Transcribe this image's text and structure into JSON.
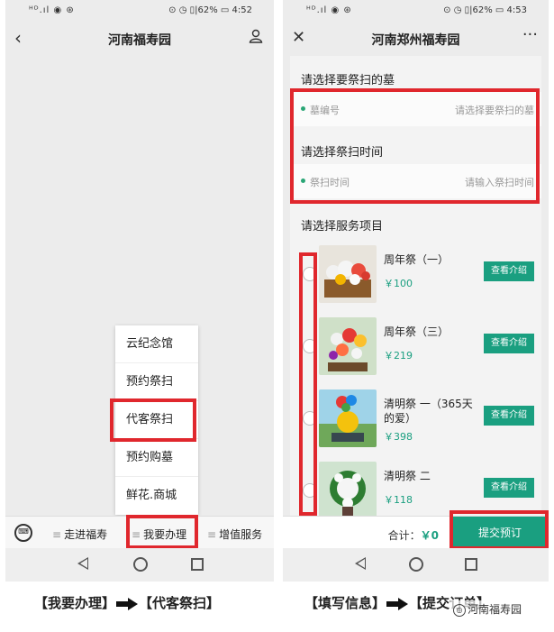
{
  "left": {
    "status_left": "ᴴᴰ.ıl ◉ ⊛",
    "status_right": "⊙ ◷ ▯|62% ▭ 4:52",
    "title": "河南福寿园",
    "back_icon": "chevron-left-icon",
    "user_icon": "user-icon",
    "menu_items": [
      "云纪念馆",
      "预约祭扫",
      "代客祭扫",
      "预约购墓",
      "鲜花.商城"
    ],
    "tabs": [
      "走进福寿",
      "我要办理",
      "增值服务"
    ]
  },
  "right": {
    "status_left": "ᴴᴰ.ıl ◉ ⊛",
    "status_right": "⊙ ◷ ▯|62% ▭ 4:53",
    "title": "河南郑州福寿园",
    "close_icon": "close-icon",
    "more_icon": "more-icon",
    "section_tomb": "请选择要祭扫的墓",
    "tomb_label": "墓编号",
    "tomb_placeholder": "请选择要祭扫的墓",
    "section_time": "请选择祭扫时间",
    "time_label": "祭扫时间",
    "time_placeholder": "请输入祭扫时间",
    "section_service": "请选择服务项目",
    "services": [
      {
        "name": "周年祭（一）",
        "price": "￥100",
        "button": "查看介绍"
      },
      {
        "name": "周年祭（三）",
        "price": "￥219",
        "button": "查看介绍"
      },
      {
        "name": "清明祭 一（365天的爱）",
        "price": "￥398",
        "button": "查看介绍"
      },
      {
        "name": "清明祭 二",
        "price": "￥118",
        "button": "查看介绍"
      }
    ],
    "total_label": "合计：",
    "total_amount": "￥0",
    "submit_label": "提交预订"
  },
  "captions": {
    "left_a": "【我要办理】",
    "left_b": "【代客祭扫】",
    "right_a": "【填写信息】",
    "right_b": "【提交订单】"
  },
  "watermark": "河南福寿园",
  "colors": {
    "accent": "#1a9f80",
    "highlight_border": "#e0272d"
  }
}
